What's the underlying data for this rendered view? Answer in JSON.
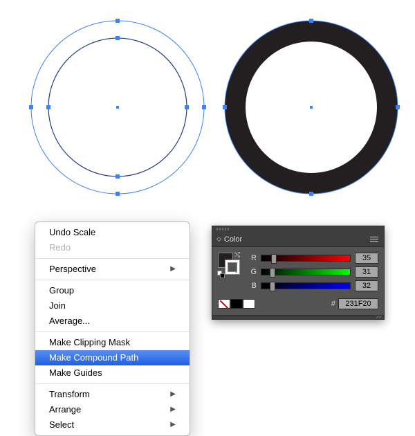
{
  "canvas": {
    "left_circle": {
      "outer_r": 125,
      "inner_r": 100,
      "selected": true
    },
    "right_circle": {
      "outer_r": 125,
      "inner_r": 95,
      "fill": "#231F20",
      "selected": true
    }
  },
  "context_menu": {
    "items": [
      {
        "label": "Undo Scale",
        "disabled": false
      },
      {
        "label": "Redo",
        "disabled": true
      },
      {
        "sep": true
      },
      {
        "label": "Perspective",
        "submenu": true
      },
      {
        "sep": true
      },
      {
        "label": "Group"
      },
      {
        "label": "Join"
      },
      {
        "label": "Average..."
      },
      {
        "sep": true
      },
      {
        "label": "Make Clipping Mask"
      },
      {
        "label": "Make Compound Path",
        "highlight": true
      },
      {
        "label": "Make Guides"
      },
      {
        "sep": true
      },
      {
        "label": "Transform",
        "submenu": true
      },
      {
        "label": "Arrange",
        "submenu": true
      },
      {
        "label": "Select",
        "submenu": true
      }
    ]
  },
  "color_panel": {
    "title": "Color",
    "r": 35,
    "g": 31,
    "b": 32,
    "hex": "231F20"
  }
}
